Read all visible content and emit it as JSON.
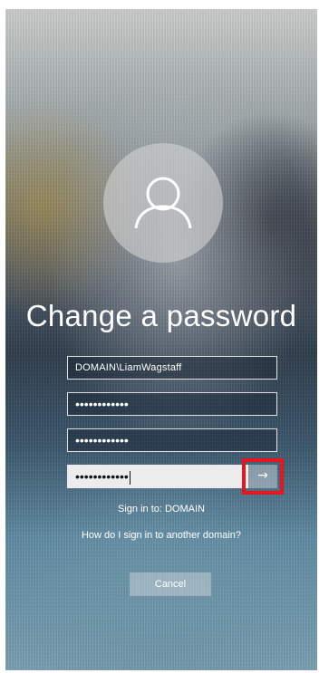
{
  "page": {
    "title": "Change a password",
    "accent_color": "#e4151d"
  },
  "form": {
    "username_value": "DOMAIN\\LiamWagstaff",
    "old_password_mask": "••••••••••••",
    "new_password_mask": "••••••••••••",
    "confirm_password_mask": "••••••••••••",
    "submit_icon": "arrow-right-icon",
    "submit_glyph": "→"
  },
  "links": {
    "sign_in_to": "Sign in to: DOMAIN",
    "other_domain": "How do I sign in to another domain?"
  },
  "buttons": {
    "cancel_label": "Cancel"
  },
  "icons": {
    "avatar": "user-icon"
  }
}
